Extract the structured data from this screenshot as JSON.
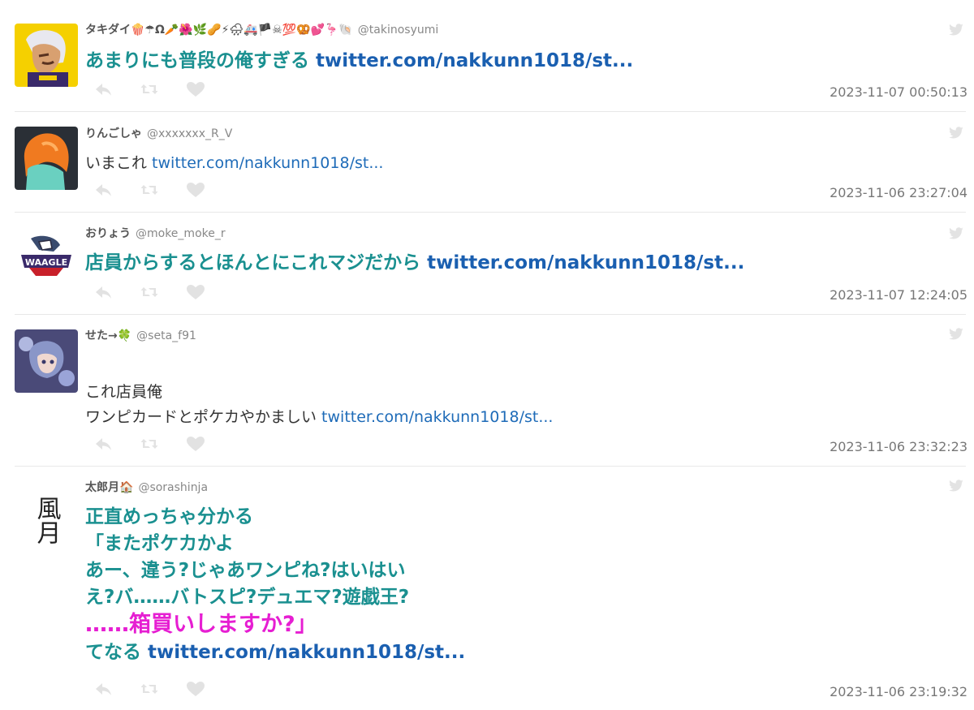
{
  "tweets": [
    {
      "name": "タキダイ🍿☂Ω🥕🌺🌿🥜⚡🌧🚑🏴☠💯🥨💕🦩🐚",
      "handle": "@takinosyumi",
      "text": "あまりにも普段の俺すぎる ",
      "link": "twitter.com/nakkunn1018/st...",
      "timestamp": "2023-11-07 00:50:13"
    },
    {
      "name": "りんごしゃ",
      "handle": "@xxxxxxx_R_V",
      "text": "いまこれ ",
      "link": "twitter.com/nakkunn1018/st...",
      "timestamp": "2023-11-06 23:27:04"
    },
    {
      "name": "おりょう",
      "handle": "@moke_moke_r",
      "text": "店員からするとほんとにこれマジだから ",
      "link": "twitter.com/nakkunn1018/st...",
      "avatar_text": "WAAGLE",
      "timestamp": "2023-11-07 12:24:05"
    },
    {
      "name": "せた→🍀",
      "handle": "@seta_f91",
      "text_line1": "これ店員俺",
      "text_line2": "ワンピカードとポケカやかましい ",
      "link": "twitter.com/nakkunn1018/st...",
      "timestamp": "2023-11-06 23:32:23"
    },
    {
      "name": "太郎月🏠",
      "handle": "@sorashinja",
      "avatar_text": "風月",
      "text_main": "正直めっちゃ分かる\n「またポケカかよ\nあー、違う?じゃあワンピね?はいはい\nえ?バ……バトスピ?デュエマ?遊戯王?\n",
      "text_magenta": "……箱買いしますか?」",
      "text_tail": "\nてなる ",
      "link": "twitter.com/nakkunn1018/st...",
      "timestamp": "2023-11-06 23:19:32"
    }
  ],
  "icons": {
    "reply": "reply-icon",
    "retweet": "retweet-icon",
    "like": "heart-icon",
    "bird": "twitter-bird-icon"
  },
  "colors": {
    "emphasis_text": "#1a9090",
    "link": "#1e6bb8",
    "highlight": "#e61ed2"
  }
}
